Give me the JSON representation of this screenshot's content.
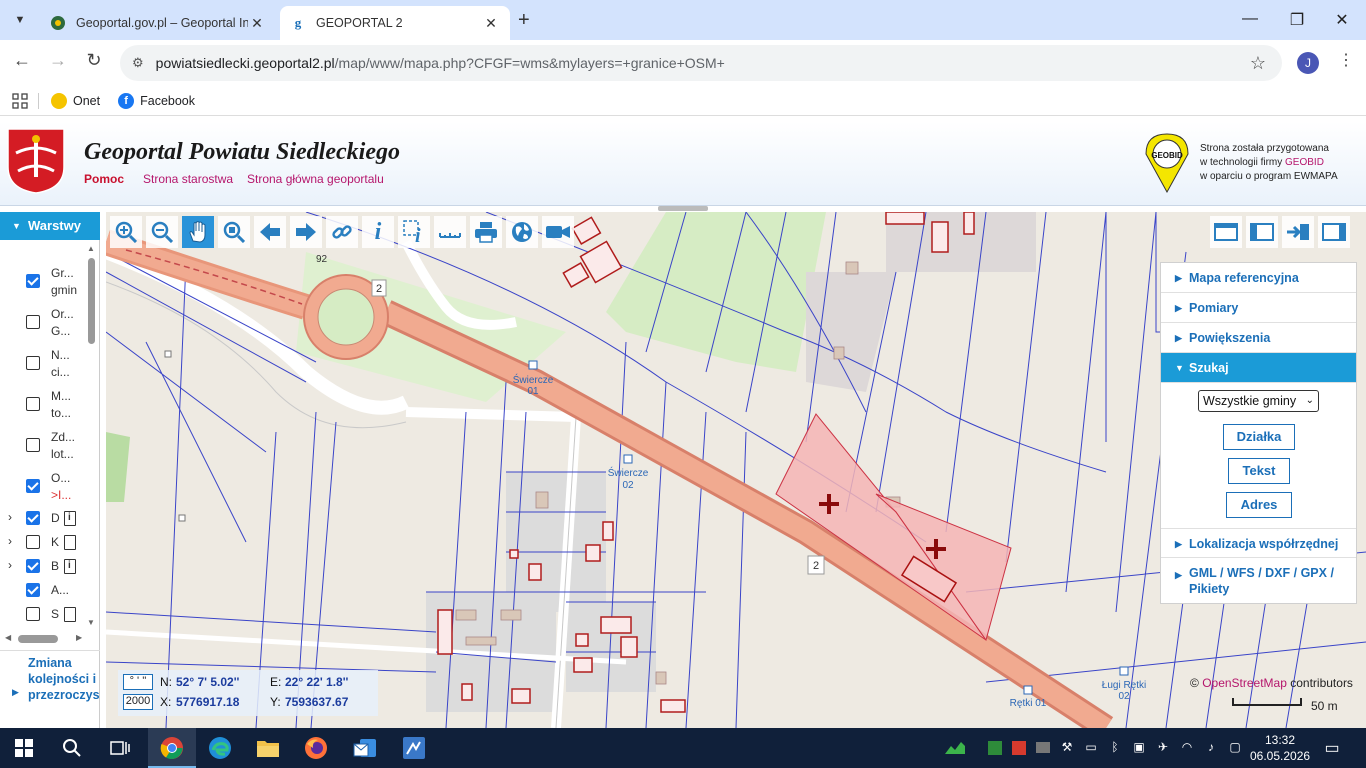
{
  "browser": {
    "tabs": [
      {
        "title": "Geoportal.gov.pl – Geoportal In",
        "active": false,
        "favicon": "geoportal-favicon"
      },
      {
        "title": "GEOPORTAL 2",
        "active": true,
        "favicon": "g-favicon"
      }
    ],
    "url_host": "powiatsiedlecki.geoportal2.pl",
    "url_path": "/map/www/mapa.php?CFGF=wms&mylayers=+granice+OSM+",
    "profile_initial": "J",
    "bookmarks": [
      {
        "label": "Onet",
        "color": "#f5c400"
      },
      {
        "label": "Facebook",
        "color": "#1877f2"
      }
    ]
  },
  "header": {
    "title": "Geoportal Powiatu Siedleckiego",
    "links": [
      "Pomoc",
      "Strona starostwa",
      "Strona główna geoportalu"
    ],
    "geobid_logo": "GEOBID",
    "geobid_line1": "Strona została przygotowana",
    "geobid_line2a": "w technologii firmy ",
    "geobid_line2b": "GEOBID",
    "geobid_line3": "w oparciu o program EWMAPA"
  },
  "layers_panel": {
    "title": "Warstwy",
    "layers": [
      {
        "line1": "Gr...",
        "line2": "gmin",
        "checked": true
      },
      {
        "line1": "Or...",
        "line2": "G...",
        "checked": false
      },
      {
        "line1": "N...",
        "line2": "ci...",
        "checked": false
      },
      {
        "line1": "M...",
        "line2": "to...",
        "checked": false
      },
      {
        "line1": "Zd...",
        "line2": "lot...",
        "checked": false
      },
      {
        "line1": "O...",
        "line2": ">I...",
        "checked": true
      },
      {
        "line1": "D",
        "checked": true,
        "expandable": true,
        "icon": "doc-info"
      },
      {
        "line1": "K",
        "checked": false,
        "expandable": true,
        "icon": "doc"
      },
      {
        "line1": "B",
        "checked": true,
        "expandable": true,
        "icon": "doc-info"
      },
      {
        "line1": "A...",
        "checked": true
      },
      {
        "line1": "S",
        "checked": false,
        "icon": "doc"
      }
    ],
    "footer": "Zmiana kolejności i przezroczys"
  },
  "map_toolbar": [
    "zoom-in-icon",
    "zoom-out-icon",
    "pan-hand-icon",
    "zoom-window-icon",
    "back-icon",
    "forward-icon",
    "link-icon",
    "info-icon",
    "info-area-icon",
    "measure-icon",
    "print-icon",
    "globe-icon",
    "camera-icon"
  ],
  "map_labels": {
    "road_number_1": "2",
    "road_number_2": "2",
    "house_number": "92",
    "stop1_name": "Świercze",
    "stop1_num": "01",
    "stop2_name": "Świercze",
    "stop2_num": "02",
    "stop3_name": "Rętki 01",
    "stop4_name": "Ługi Rętki",
    "stop4_num": "02"
  },
  "right_panel": {
    "items": [
      {
        "label": "Mapa referencyjna",
        "active": false
      },
      {
        "label": "Pomiary",
        "active": false
      },
      {
        "label": "Powiększenia",
        "active": false
      },
      {
        "label": "Szukaj",
        "active": true
      }
    ],
    "select_value": "Wszystkie gminy",
    "buttons": [
      "Działka",
      "Tekst",
      "Adres"
    ],
    "bottom_items": [
      {
        "label": "Lokalizacja współrzędnej"
      },
      {
        "label1": "GML / WFS / DXF / GPX /",
        "label2": "Pikiety"
      }
    ]
  },
  "coords": {
    "fmt_deg": "° ' ''",
    "fmt_epsg": "2000",
    "n_label": "N:",
    "n_value": "52° 7' 5.02''",
    "e_label": "E:",
    "e_value": "22° 22' 1.8''",
    "x_label": "X:",
    "x_value": "5776917.18",
    "y_label": "Y:",
    "y_value": "7593637.67"
  },
  "attribution": {
    "prefix": "© ",
    "link": "OpenStreetMap",
    "suffix": " contributors"
  },
  "scale": "50 m",
  "taskbar": {
    "time": "13:32",
    "date": "06.05.2026"
  },
  "colors": {
    "accent": "#1b9bd7",
    "link": "#1b6fb8",
    "magenta": "#b5166c",
    "parcel_fill": "#f5b5b5",
    "road": "#e8967a"
  }
}
